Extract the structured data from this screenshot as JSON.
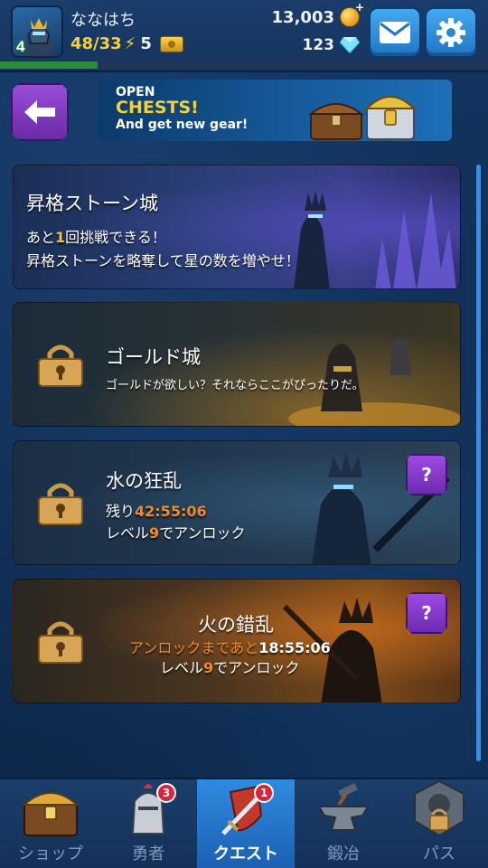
{
  "player": {
    "name": "ななはち",
    "level": "4",
    "energy": "48/33",
    "tickets": "5",
    "gold": "13,003",
    "gems": "123",
    "xp_progress_percent": 20
  },
  "icons": {
    "mail": "mail-icon",
    "settings": "gear-icon",
    "back": "back-arrow-icon",
    "lock": "lock-icon",
    "question": "question-icon"
  },
  "banner": {
    "line1": "OPEN",
    "line2": "CHESTS!",
    "line3": "And get new gear!"
  },
  "quests": {
    "ascend": {
      "title": "昇格ストーン城",
      "line1_pre": "あと",
      "line1_num": "1",
      "line1_post": "回挑戦できる！",
      "line2": "昇格ストーンを略奪して星の数を増やせ！"
    },
    "gold": {
      "title": "ゴールド城",
      "desc": "ゴールドが欲しい？それならここがぴったりだ。"
    },
    "water": {
      "title": "水の狂乱",
      "remaining_label": "残り",
      "remaining_time": "42:55:06",
      "unlock_pre": "レベル",
      "unlock_level": "9",
      "unlock_post": "でアンロック"
    },
    "fire": {
      "title": "火の錯乱",
      "until_label": "アンロックまであと",
      "until_time": "18:55:06",
      "unlock_pre": "レベル",
      "unlock_level": "9",
      "unlock_post": "でアンロック"
    }
  },
  "nav": {
    "shop": "ショップ",
    "heroes": "勇者",
    "heroes_badge": "3",
    "quest": "クエスト",
    "quest_badge": "1",
    "forge": "鍛冶",
    "pass": "パス"
  },
  "colors": {
    "accent_yellow": "#f5c33a",
    "accent_orange": "#f08a2a",
    "active_tab": "#2f8be0",
    "purple_button": "#9a4dd8"
  }
}
